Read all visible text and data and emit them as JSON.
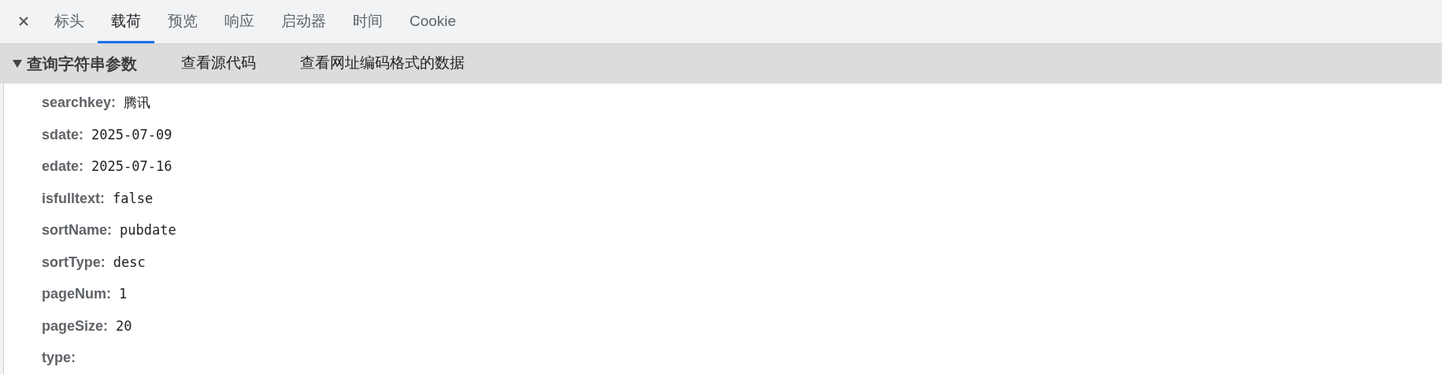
{
  "tabs": [
    {
      "label": "标头",
      "selected": false
    },
    {
      "label": "载荷",
      "selected": true
    },
    {
      "label": "预览",
      "selected": false
    },
    {
      "label": "响应",
      "selected": false
    },
    {
      "label": "启动器",
      "selected": false
    },
    {
      "label": "时间",
      "selected": false
    },
    {
      "label": "Cookie",
      "selected": false
    }
  ],
  "section": {
    "title": "查询字符串参数",
    "expanded": true,
    "links": [
      "查看源代码",
      "查看网址编码格式的数据"
    ]
  },
  "params": [
    {
      "key": "searchkey:",
      "value": "腾讯"
    },
    {
      "key": "sdate:",
      "value": "2025-07-09"
    },
    {
      "key": "edate:",
      "value": "2025-07-16"
    },
    {
      "key": "isfulltext:",
      "value": "false"
    },
    {
      "key": "sortName:",
      "value": "pubdate"
    },
    {
      "key": "sortType:",
      "value": "desc"
    },
    {
      "key": "pageNum:",
      "value": "1"
    },
    {
      "key": "pageSize:",
      "value": "20"
    },
    {
      "key": "type:"
    }
  ]
}
